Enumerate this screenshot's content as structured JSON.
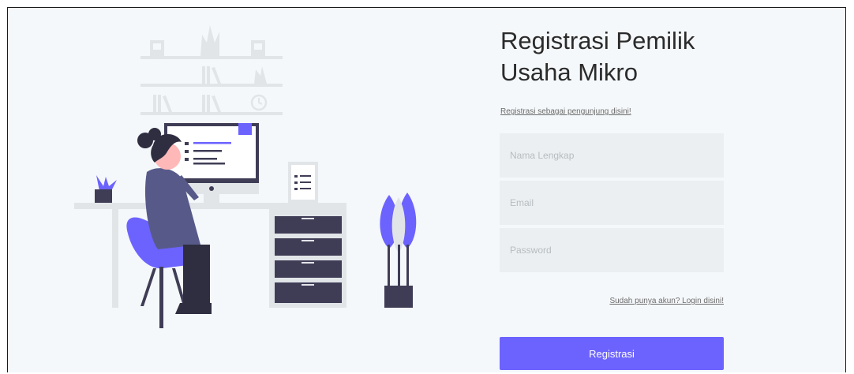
{
  "form": {
    "title_line1": "Registrasi Pemilik",
    "title_line2": "Usaha Mikro",
    "visitor_link": "Registrasi sebagai pengunjung disini!",
    "name_placeholder": "Nama Lengkap",
    "email_placeholder": "Email",
    "password_placeholder": "Password",
    "login_link": "Sudah punya akun? Login disini!",
    "submit_label": "Registrasi"
  },
  "colors": {
    "accent": "#6c63ff",
    "field_background": "#eceff1",
    "page_background": "#f5f8fa"
  },
  "illustration": {
    "subject": "woman-working-at-desk-illustration"
  }
}
